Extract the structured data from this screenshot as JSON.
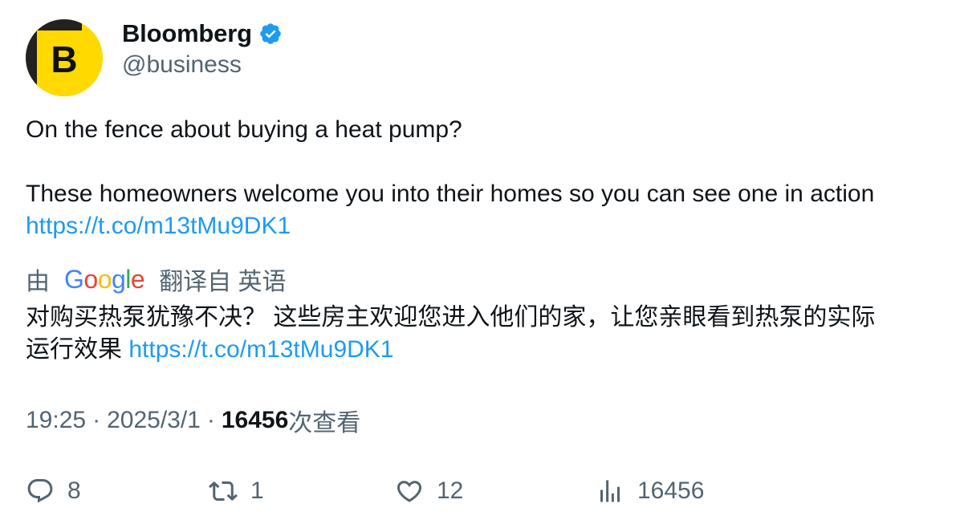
{
  "author": {
    "avatar_letter": "B",
    "avatar_color": "#ffd900",
    "display_name": "Bloomberg",
    "verified_color": "#1d9bf0",
    "handle": "@business"
  },
  "tweet": {
    "line1": "On the fence about buying a heat pump?",
    "line2": "These homeowners welcome you into their homes so you can see one in action",
    "link": "https://t.co/m13tMu9DK1"
  },
  "translation": {
    "prefix": "由",
    "provider": "Google",
    "suffix": "翻译自 英语",
    "line1": "对购买热泵犹豫不决？ 这些房主欢迎您进入他们的家，让您亲眼看到热泵的实际",
    "line2": "运行效果",
    "link": "https://t.co/m13tMu9DK1"
  },
  "meta": {
    "time": "19:25",
    "separator": "·",
    "date": "2025/3/1",
    "views_count": "16456",
    "views_label": "次查看"
  },
  "actions": {
    "replies": "8",
    "retweets": "1",
    "likes": "12",
    "views": "16456"
  },
  "icons": {
    "reply": "reply-icon",
    "retweet": "retweet-icon",
    "like": "heart-icon",
    "views": "analytics-icon",
    "verified": "verified-badge-icon"
  }
}
